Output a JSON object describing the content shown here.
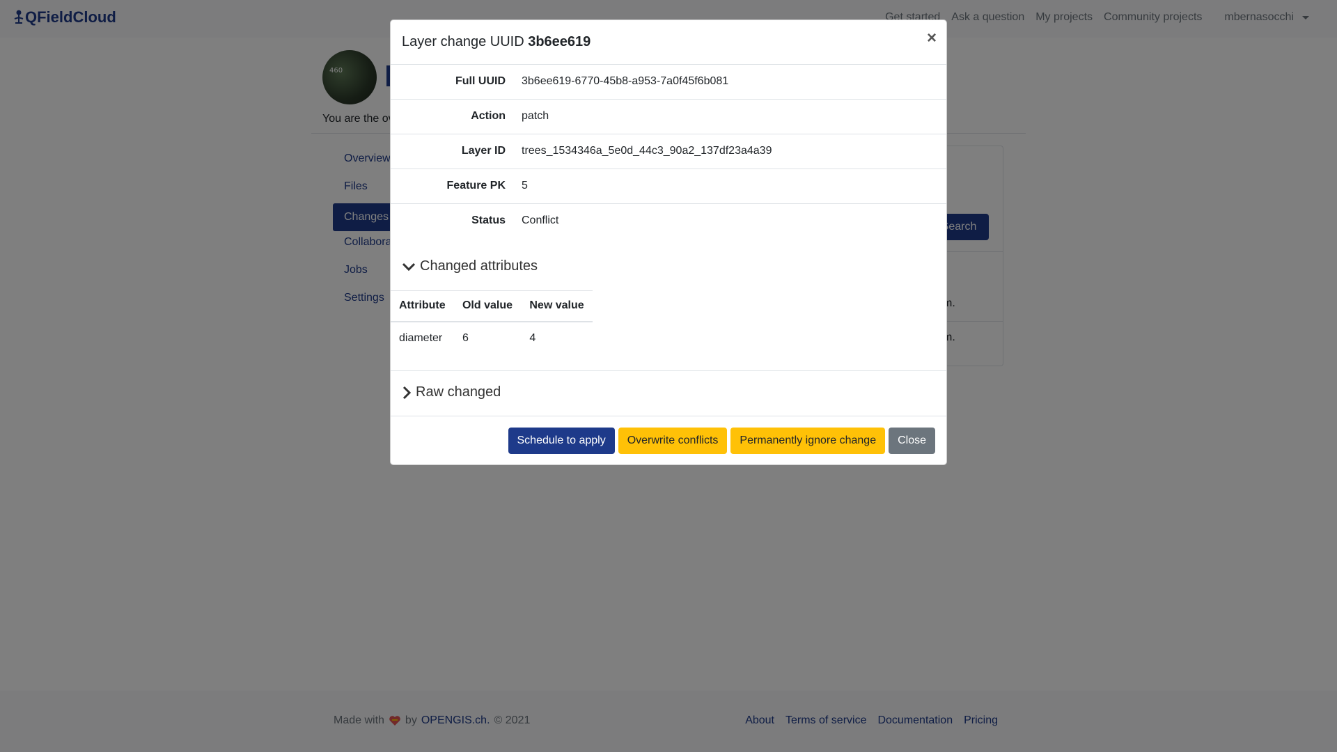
{
  "navbar": {
    "brand": "QFieldCloud",
    "links": [
      "Get started",
      "Ask a question",
      "My projects",
      "Community projects"
    ],
    "user": "mbernasocchi"
  },
  "project": {
    "avatar_text": "460",
    "owner_text": "You are the ov"
  },
  "sidebar": {
    "items": [
      {
        "label": "Overview"
      },
      {
        "label": "Files"
      },
      {
        "label": "Changes"
      },
      {
        "label": "Collabora"
      },
      {
        "label": "Jobs"
      },
      {
        "label": "Settings"
      }
    ]
  },
  "background": {
    "search_label": "Search",
    "row1_tail": "m.",
    "row2_tail": "m."
  },
  "modal": {
    "title_prefix": "Layer change UUID",
    "title_uuid": "3b6ee619",
    "close_symbol": "×",
    "details": [
      {
        "key": "Full UUID",
        "value": "3b6ee619-6770-45b8-a953-7a0f45f6b081"
      },
      {
        "key": "Action",
        "value": "patch"
      },
      {
        "key": "Layer ID",
        "value": "trees_1534346a_5e0d_44c3_90a2_137df23a4a39"
      },
      {
        "key": "Feature PK",
        "value": "5"
      },
      {
        "key": "Status",
        "value": "Conflict"
      }
    ],
    "changed_attributes_label": "Changed attributes",
    "attributes_table": {
      "headers": [
        "Attribute",
        "Old value",
        "New value"
      ],
      "rows": [
        [
          "diameter",
          "6",
          "4"
        ]
      ]
    },
    "raw_changed_label": "Raw changed",
    "buttons": {
      "schedule": "Schedule to apply",
      "overwrite": "Overwrite conflicts",
      "ignore": "Permanently ignore change",
      "close": "Close"
    }
  },
  "footer": {
    "made_with": "Made with",
    "by": "by",
    "company": "OPENGIS.ch.",
    "copyright": "© 2021",
    "links": [
      "About",
      "Terms of service",
      "Documentation",
      "Pricing"
    ]
  },
  "colors": {
    "primary": "#1e3a8a",
    "warning": "#ffc107",
    "secondary": "#6c757d"
  }
}
